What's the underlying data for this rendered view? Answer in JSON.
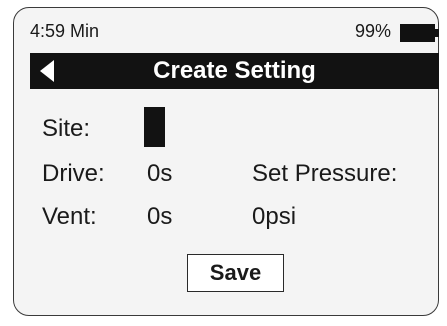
{
  "status_bar": {
    "time": "4:59 Min",
    "battery_percent": "99%"
  },
  "header": {
    "title": "Create Setting"
  },
  "form": {
    "site_label": "Site:",
    "drive_label": "Drive:",
    "drive_value": "0s",
    "vent_label": "Vent:",
    "vent_value": "0s",
    "set_pressure_label": "Set Pressure:",
    "set_pressure_value": "0psi"
  },
  "actions": {
    "save_label": "Save"
  },
  "colors": {
    "dark": "#121212",
    "background": "#f4f4f4"
  }
}
